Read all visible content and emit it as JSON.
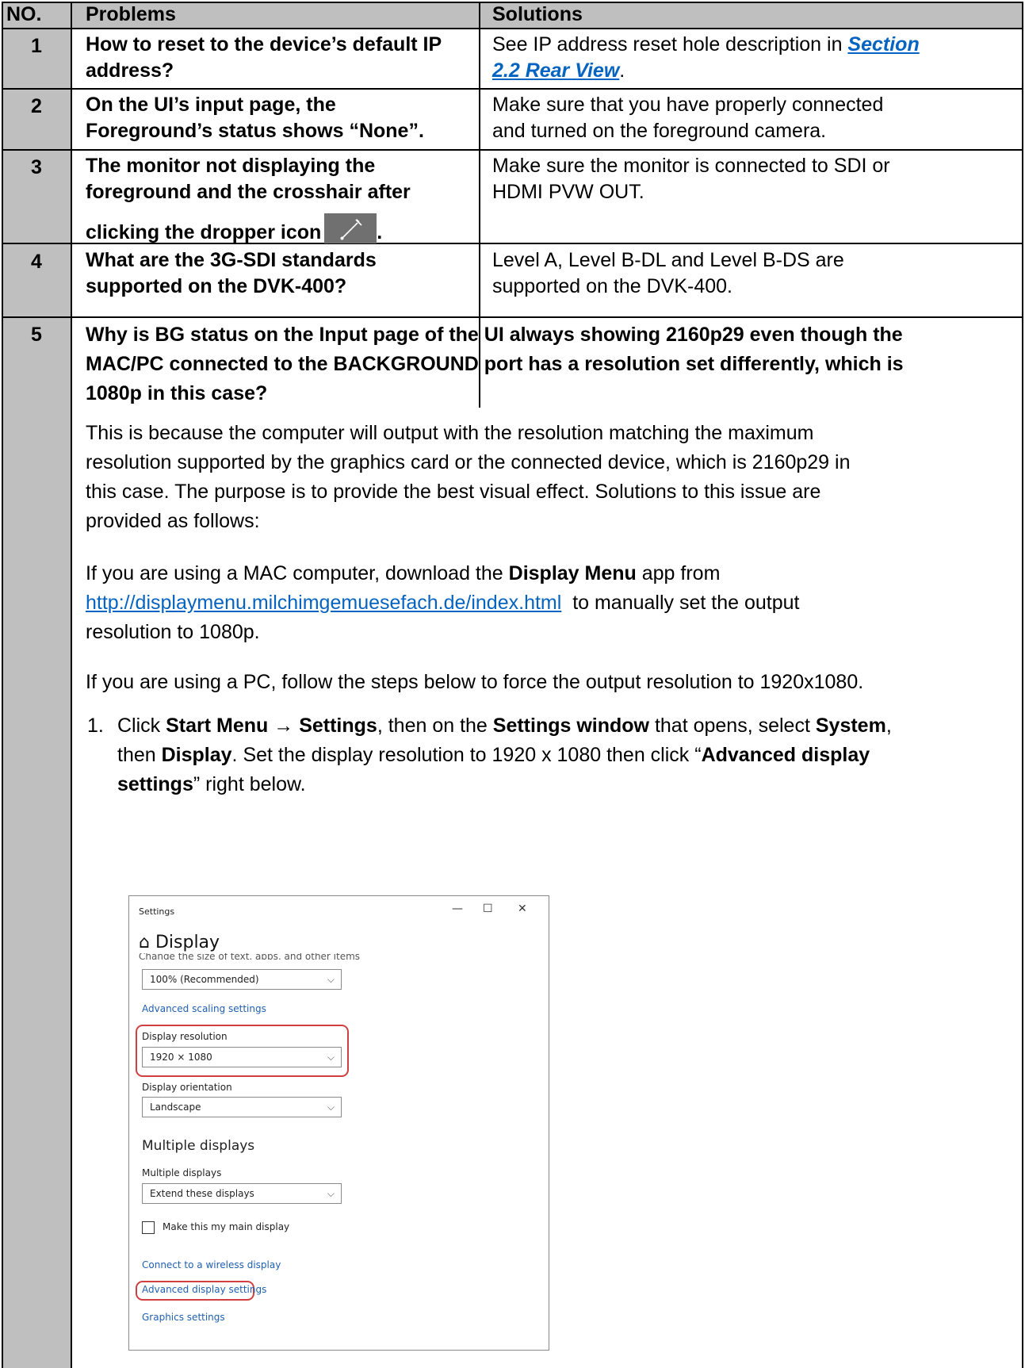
{
  "headers": {
    "no": "NO.",
    "problems": "Problems",
    "solutions": "Solutions"
  },
  "rows": [
    {
      "no": "1",
      "problem": [
        "How to reset to the device’s default IP",
        "address?"
      ],
      "solution_text": "See IP address reset hole description in ",
      "solution_link_1": "Section",
      "solution_link_2": "2.2 Rear View",
      "solution_end": "."
    },
    {
      "no": "2",
      "problem": [
        "On the UI’s input page, the",
        "Foreground’s status shows “None”."
      ],
      "solution": [
        "Make sure that you have properly connected",
        "and turned on the foreground camera."
      ]
    },
    {
      "no": "3",
      "problem": [
        "The monitor not displaying the",
        "foreground and the crosshair after",
        "clicking the dropper icon"
      ],
      "problem_end": ".",
      "solution": [
        "Make sure the monitor is connected to SDI or",
        "HDMI PVW OUT."
      ]
    },
    {
      "no": "4",
      "problem": [
        "What are the 3G-SDI standards",
        "supported on the DVK-400?"
      ],
      "solution": [
        "Level A, Level B-DL and Level B-DS are",
        "supported on the DVK-400."
      ]
    }
  ],
  "row5": {
    "no": "5",
    "question": [
      "Why is BG status on the Input page of the UI always showing 2160p29 even though the",
      "MAC/PC connected to the BACKGROUND port has a resolution set differently, which is",
      "1080p in this case?"
    ],
    "para1": [
      "This is because the computer will output with the resolution matching the maximum",
      "resolution supported by the graphics card or the connected device, which is 2160p29 in",
      "this case. The purpose is to provide the best visual effect. Solutions to this issue are",
      "provided as follows:"
    ],
    "mac_a": "If you are using a MAC computer, download the ",
    "mac_b": "Display Menu",
    "mac_c": " app from",
    "mac_url": "http://displaymenu.milchimgemuesefach.de/index.html",
    "mac_d": "  to manually set the output",
    "mac_e": "resolution to 1080p.",
    "pc": "If you are using a PC, follow the steps below to force the output resolution to 1920x1080.",
    "step_no": "1.",
    "step": {
      "a": "Click ",
      "b": "Start Menu",
      "c": " → ",
      "d": "Settings",
      "e": ", then on the ",
      "f": "Settings window",
      "g": " that opens, select ",
      "h": "System",
      "i": ",",
      "j": "then ",
      "k": "Display",
      "l": ". Set the display resolution to 1920 x 1080 then click “",
      "m": "Advanced display",
      "n": "settings",
      "o": "” right below."
    }
  },
  "settings_window": {
    "title": "Settings",
    "min": "—",
    "max": "☐",
    "close": "✕",
    "header": "⌂ Display",
    "clipped": "Change the size of text, apps, and other items",
    "scale_value": "100% (Recommended)",
    "adv_scaling": "Advanced scaling settings",
    "res_label": "Display resolution",
    "res_value": "1920 × 1080",
    "orient_label": "Display orientation",
    "orient_value": "Landscape",
    "multi_heading": "Multiple displays",
    "multi_label": "Multiple displays",
    "multi_value": "Extend these displays",
    "main_display": "Make this my main display",
    "wireless": "Connect to a wireless display",
    "adv_display": "Advanced display settings",
    "graphics": "Graphics settings",
    "chevron": "⌵"
  }
}
